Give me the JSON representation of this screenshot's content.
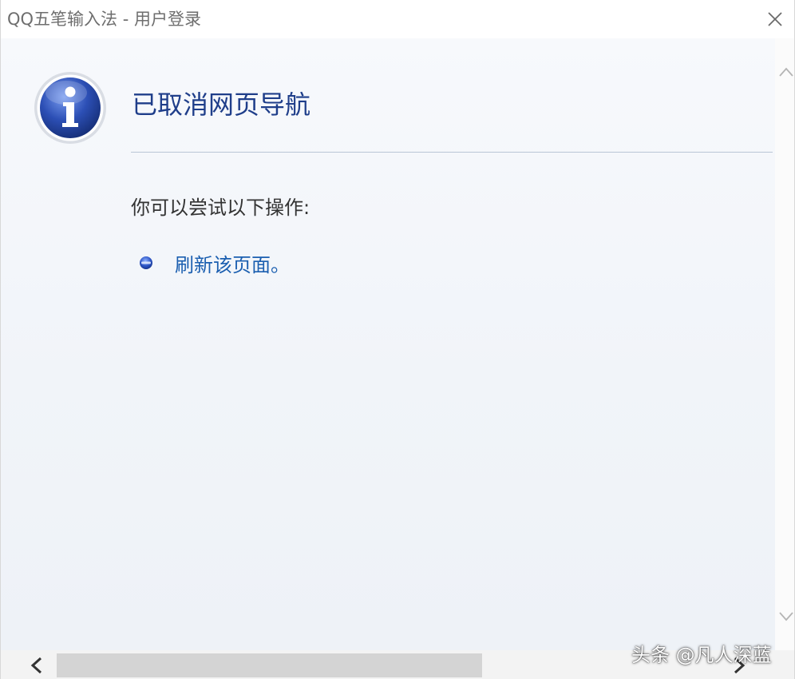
{
  "window": {
    "title": "QQ五笔输入法 - 用户登录"
  },
  "message": {
    "heading": "已取消网页导航",
    "subtext": "你可以尝试以下操作:",
    "actions": [
      {
        "label": "刷新该页面。"
      }
    ]
  },
  "watermark": {
    "text": "头条 @凡人深蓝"
  },
  "colors": {
    "heading": "#1f3e8a",
    "link": "#1b5fb0",
    "info_icon": "#2c4fb5"
  },
  "icons": {
    "close": "close-icon",
    "info": "info-icon",
    "bullet": "bullet-icon",
    "scroll_up": "chevron-up-icon",
    "scroll_down": "chevron-down-icon",
    "scroll_left": "chevron-left-icon",
    "scroll_right": "chevron-right-icon"
  }
}
